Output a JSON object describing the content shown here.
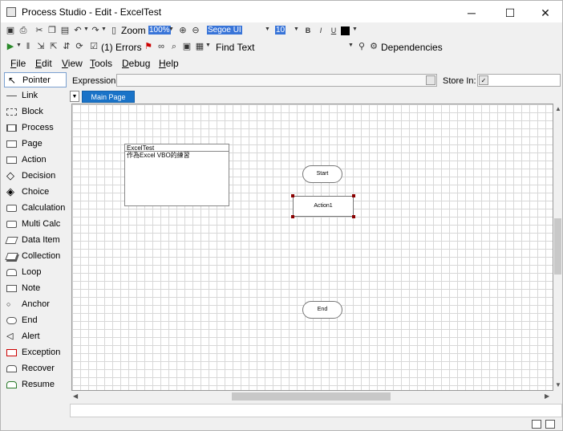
{
  "window": {
    "title": "Process Studio  - Edit - ExcelTest",
    "minimize": "─",
    "maximize": "☐",
    "close": "✕"
  },
  "toolbar1": {
    "zoom_label": "Zoom",
    "zoom_value": "100%",
    "font_name": "Segoe UI",
    "font_size": "10",
    "bold": "B",
    "italic": "I",
    "underline": "U"
  },
  "toolbar2": {
    "errors_label": "(1) Errors",
    "find_text_label": "Find Text",
    "dependencies_label": "Dependencies"
  },
  "menu": [
    {
      "key": "F",
      "rest": "ile"
    },
    {
      "key": "E",
      "rest": "dit"
    },
    {
      "key": "V",
      "rest": "iew"
    },
    {
      "key": "T",
      "rest": "ools"
    },
    {
      "key": "D",
      "rest": "ebug"
    },
    {
      "key": "H",
      "rest": "elp"
    }
  ],
  "toolbox": {
    "items": [
      "Pointer",
      "Link",
      "Block",
      "Process",
      "Page",
      "Action",
      "Decision",
      "Choice",
      "Calculation",
      "Multi Calc",
      "Data Item",
      "Collection",
      "Loop",
      "Note",
      "Anchor",
      "End",
      "Alert",
      "Exception",
      "Recover",
      "Resume"
    ]
  },
  "expression": {
    "label": "Expression:",
    "value": ""
  },
  "store_in": {
    "label": "Store In:",
    "value": ""
  },
  "tabs": {
    "main_page": "Main Page"
  },
  "canvas": {
    "note_title": "ExcelTest",
    "note_text": "作為Excel VBO的練習",
    "start_label": "Start",
    "action_label": "Action1",
    "end_label": "End"
  }
}
